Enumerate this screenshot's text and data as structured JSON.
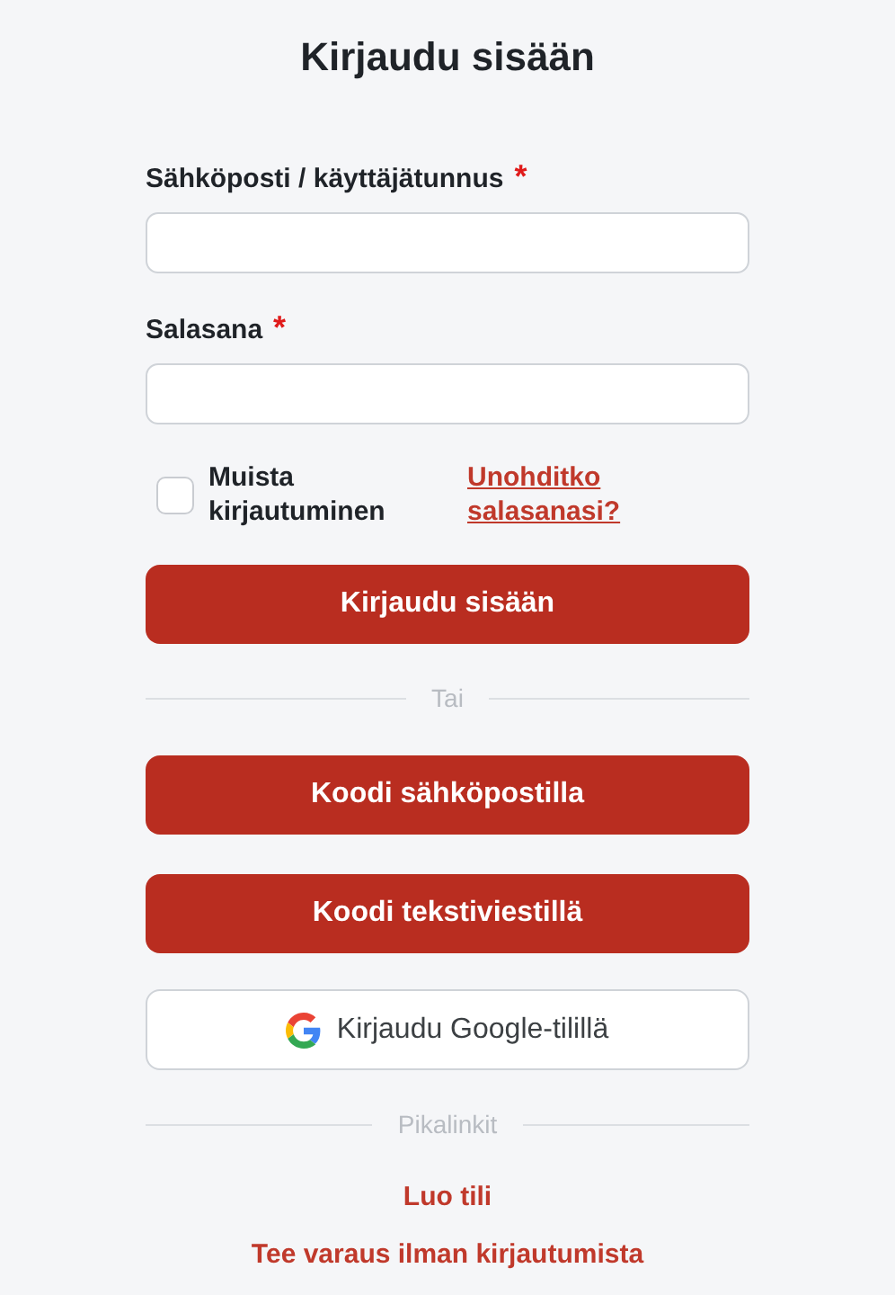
{
  "title": "Kirjaudu sisään",
  "fields": [
    {
      "label": "Sähköposti / käyttäjätunnus",
      "required_mark": "*"
    },
    {
      "label": "Salasana",
      "required_mark": "*"
    }
  ],
  "remember": {
    "label": "Muista kirjautuminen",
    "checked": false
  },
  "forgot_link": "Unohditko salasanasi?",
  "submit": "Kirjaudu sisään",
  "divider_1": "Tai",
  "alt_buttons": [
    {
      "kind": "primary",
      "label": "Koodi sähköpostilla"
    },
    {
      "kind": "primary",
      "label": "Koodi tekstiviestillä"
    },
    {
      "kind": "google",
      "label": "Kirjaudu Google-tilillä"
    }
  ],
  "divider_2": "Pikalinkit",
  "quick_links": [
    "Luo tili",
    "Tee varaus ilman kirjautumista"
  ]
}
